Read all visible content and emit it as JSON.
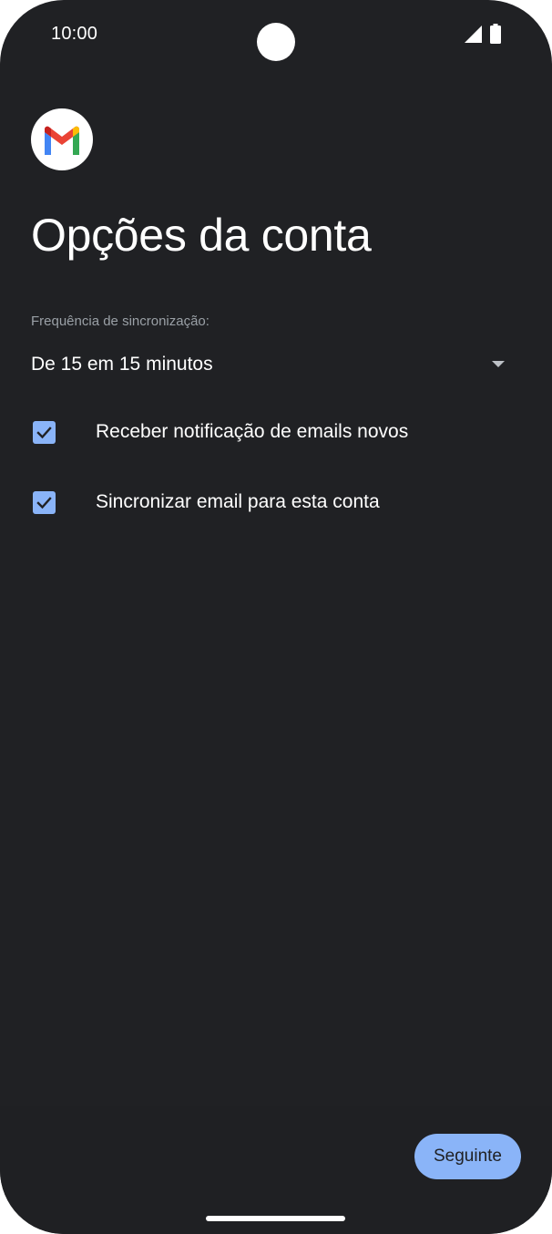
{
  "status_bar": {
    "time": "10:00",
    "icons": [
      "signal-icon",
      "battery-icon"
    ]
  },
  "app": {
    "logo_icon": "gmail-logo-icon"
  },
  "title": "Opções da conta",
  "sync": {
    "label": "Frequência de sincronização:",
    "selected": "De 15 em 15 minutos"
  },
  "options": [
    {
      "label": "Receber notificação de emails novos",
      "checked": true
    },
    {
      "label": "Sincronizar email para esta conta",
      "checked": true
    }
  ],
  "actions": {
    "next_label": "Seguinte"
  },
  "colors": {
    "background": "#202124",
    "accent": "#8ab4f8",
    "gmail_red": "#ea4335",
    "gmail_blue": "#4285f4",
    "gmail_green": "#34a853",
    "gmail_yellow": "#fbbc04"
  }
}
